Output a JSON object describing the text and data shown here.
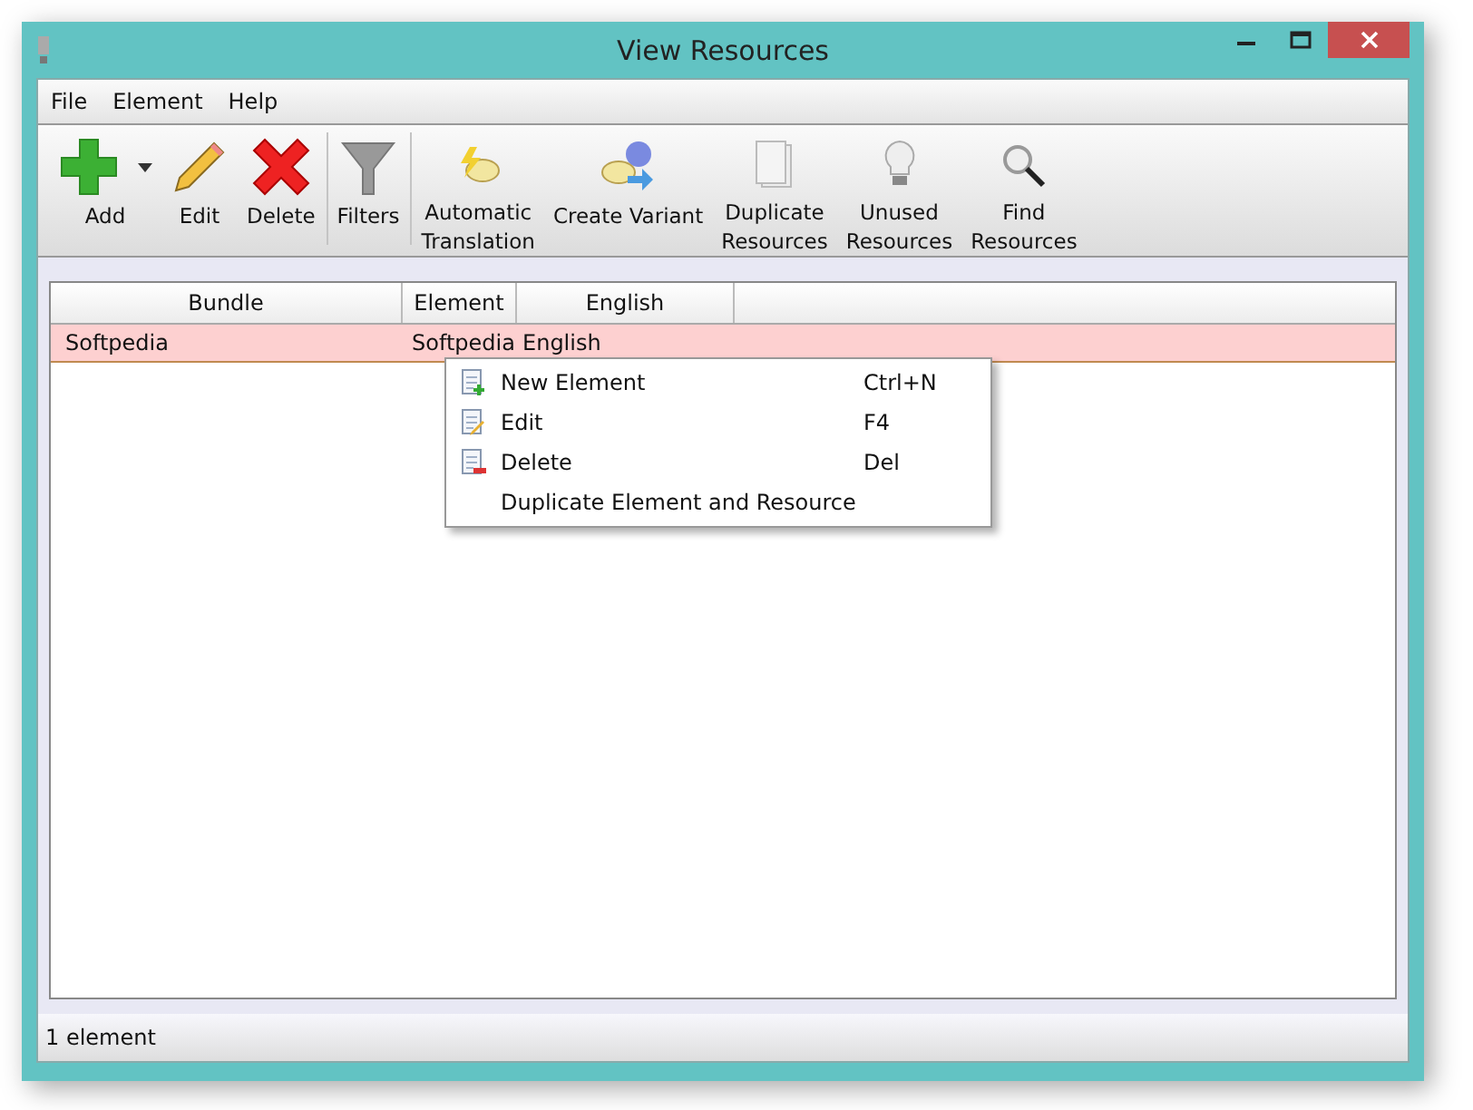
{
  "window": {
    "title": "View Resources"
  },
  "menu": [
    "File",
    "Element",
    "Help"
  ],
  "toolbar": [
    {
      "label": "Add",
      "dropdown": true,
      "separator_after": false
    },
    {
      "label": "Edit",
      "dropdown": false,
      "separator_after": false
    },
    {
      "label": "Delete",
      "dropdown": false,
      "separator_after": true
    },
    {
      "label": "Filters",
      "dropdown": false,
      "separator_after": true
    },
    {
      "label": "Automatic\nTranslation",
      "dropdown": false,
      "separator_after": false
    },
    {
      "label": "Create Variant",
      "dropdown": false,
      "separator_after": false
    },
    {
      "label": "Duplicate\nResources",
      "dropdown": false,
      "separator_after": false
    },
    {
      "label": "Unused\nResources",
      "dropdown": false,
      "separator_after": false
    },
    {
      "label": "Find\nResources",
      "dropdown": false,
      "separator_after": false
    }
  ],
  "table": {
    "columns": [
      "Bundle",
      "Element",
      "English"
    ],
    "rows": [
      {
        "cells": [
          "Softpedia",
          "Softpedia",
          "English"
        ],
        "selected": true
      }
    ]
  },
  "context_menu": [
    {
      "label": "New Element",
      "shortcut": "Ctrl+N",
      "icon": true
    },
    {
      "label": "Edit",
      "shortcut": "F4",
      "icon": true
    },
    {
      "label": "Delete",
      "shortcut": "Del",
      "icon": true
    },
    {
      "label": "Duplicate Element and Resource",
      "icon": false
    }
  ],
  "status_bar": "1 element"
}
